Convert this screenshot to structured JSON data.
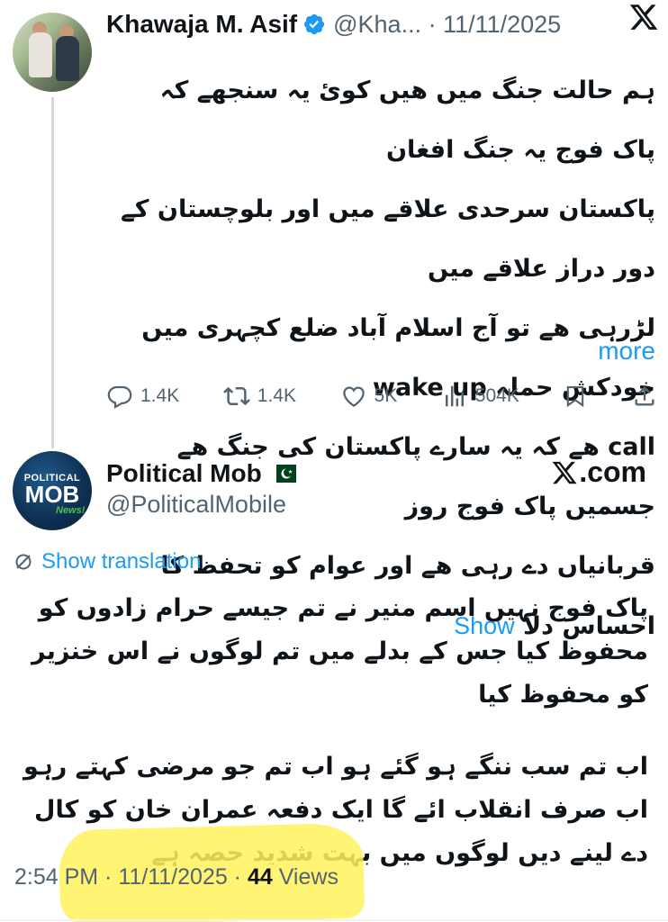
{
  "quoted_tweet": {
    "author_name": "Khawaja M. Asif",
    "handle_date": "@Kha... · 11/11/2025",
    "body_lines": [
      "ہم حالت جنگ میں ھیں کوئ یہ سنجھے کہ پاک فوج یہ جنگ افغان",
      "پاکستان سرحدی علاقے میں اور بلوچستان کے دور دراز علاقے میں",
      "لڑرہی ھے تو آج اسلام آباد ضلع کچہری میں خودکش حملہ wake up",
      "call ھے کہ یہ سارے پاکستان کی جنگ ھے جسمیں پاک فوج روز",
      "قربانیاں دے رہی ھے اور عوام کو تحفظ کا احساس دلا"
    ],
    "show": "Show",
    "more": "more",
    "replies": "1.4K",
    "reposts": "1.4K",
    "likes": "5K",
    "views": "504K"
  },
  "main_tweet": {
    "author_name": "Political Mob",
    "handle": "@PoliticalMobile",
    "site_label": ".com",
    "avatar": {
      "line1": "POLITICAL",
      "line2": "MOB",
      "line3": "News!"
    },
    "show_translation": "Show translation",
    "paragraph1": "پاک فوج نہیں اسم منیر نے تم جیسے حرام زادوں کو محفوظ کیا جس کے بدلے میں تم لوگوں نے اس خنزیر کو محفوظ کیا",
    "paragraph2": "اب تم سب ننگے ہو گئے ہو اب تم جو مرضی کہتے رہو اب صرف انقلاب ائے گا ایک دفعہ عمران خان کو کال دے لینے دیں لوگوں میں بہت شدید حصہ ہے",
    "time_date": "2:54 PM · 11/11/2025 · ",
    "views_count": "44",
    "views_label": " Views"
  },
  "colors": {
    "accent": "#1d9bf0",
    "secondary_text": "#536471",
    "highlight": "#fff25a"
  }
}
